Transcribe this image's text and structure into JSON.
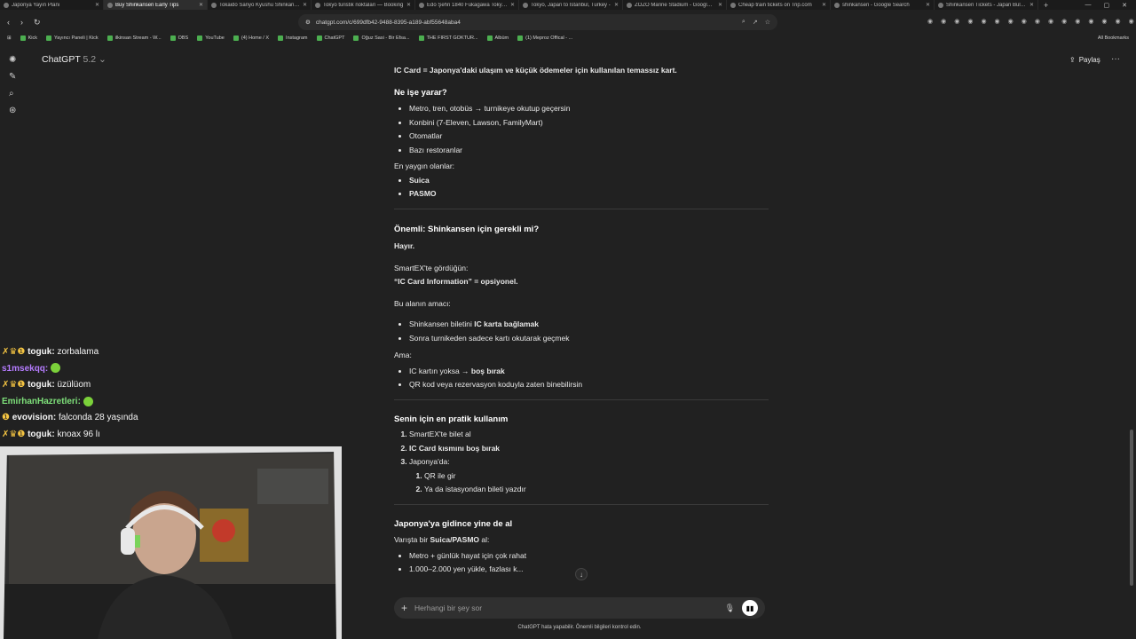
{
  "browser": {
    "tabs": [
      {
        "label": "Japonya Yayın Planı",
        "active": false
      },
      {
        "label": "Buy Shinkansen Early Tips",
        "active": true
      },
      {
        "label": "Tokaido Sanyo Kyushu Shinkansen",
        "active": false
      },
      {
        "label": "Tokyo turistik noktaları — Booking",
        "active": false
      },
      {
        "label": "Edo Şehri 1840 Fukagawa Tokyo'da",
        "active": false
      },
      {
        "label": "Tokyo, Japan to Istanbul, Turkey - ",
        "active": false
      },
      {
        "label": "ZOZO Marine Stadium - Google M",
        "active": false
      },
      {
        "label": "Cheap train tickets on Trip.com",
        "active": false
      },
      {
        "label": "shinkansen - Google Search",
        "active": false
      },
      {
        "label": "Shinkansen Tickets - Japan Bullet T",
        "active": false
      }
    ],
    "url": "chatgpt.com/c/699dfb42-9488-8395-a189-abf55648aba4",
    "bookmarks": [
      "Kick",
      "Yayıncı Paneli | Kick",
      "ilkinsan Stream - W...",
      "OBS",
      "YouTube",
      "(4) Home / X",
      "Instagram",
      "ChatGPT",
      "Oğuz Sasi - Bir Efsa...",
      "THE FIRST GOKTUR...",
      "Albüm",
      "(1) Meproz Offical - ..."
    ],
    "all_bookmarks": "All Bookmarks"
  },
  "app": {
    "model_name": "ChatGPT",
    "model_version": "5.2",
    "share_label": "Paylaş"
  },
  "message": {
    "intro_bold": "IC Card = Japonya'daki ulaşım ve küçük ödemeler için kullanılan temassız kart.",
    "s1_heading": "Ne işe yarar?",
    "s1_items": [
      "Metro, tren, otobüs → turnikeye okutup geçersin",
      "Konbini (7-Eleven, Lawson, FamilyMart)",
      "Otomatlar",
      "Bazı restoranlar"
    ],
    "s1_common": "En yaygın olanlar:",
    "s1_cards": [
      "Suica",
      "PASMO"
    ],
    "s2_heading": "Önemli: Shinkansen için gerekli mi?",
    "s2_answer": "Hayır.",
    "s2_seen": "SmartEX'te gördüğün:",
    "s2_field": "“IC Card Information” = opsiyonel.",
    "s2_purpose": "Bu alanın amacı:",
    "s2_purpose_items": [
      {
        "pre": "Shinkansen biletini ",
        "bold": "IC karta bağlamak"
      },
      {
        "pre": "Sonra turnikeden sadece kartı okutarak geçmek",
        "bold": ""
      }
    ],
    "s2_but": "Ama:",
    "s2_but_items": [
      {
        "pre": "IC kartın yoksa → ",
        "bold": "boş bırak"
      },
      {
        "pre": "QR kod veya rezervasyon koduyla zaten binebilirsin",
        "bold": ""
      }
    ],
    "s3_heading": "Senin için en pratik kullanım",
    "s3_steps": [
      "SmartEX'te bilet al",
      "IC Card kısmını boş bırak",
      "Japonya'da:"
    ],
    "s3_sub": [
      "QR ile gir",
      "Ya da istasyondan bileti yazdır"
    ],
    "s4_heading": "Japonya'ya gidince yine de al",
    "s4_line_pre": "Varışta bir ",
    "s4_line_bold": "Suica/PASMO",
    "s4_line_post": " al:",
    "s4_items": [
      "Metro + günlük hayat için çok rahat",
      "1.000–2.000 yen yükle, fazlası k..."
    ]
  },
  "composer": {
    "placeholder": "Herhangi bir şey sor",
    "disclaimer": "ChatGPT hata yapabilir. Önemli bilgileri kontrol edin."
  },
  "stream_chat": [
    {
      "user": "toguk",
      "text": "zorbalama",
      "color": "#f5f5f5",
      "badges": "✗♛❶"
    },
    {
      "user": "s1msekqq",
      "text": "",
      "color": "#b57cff",
      "badges": "",
      "emote": true
    },
    {
      "user": "toguk",
      "text": "üzülüom",
      "color": "#f5f5f5",
      "badges": "✗♛❶"
    },
    {
      "user": "EmirhanHazretleri",
      "text": "",
      "color": "#7ee07a",
      "badges": "",
      "emote": true
    },
    {
      "user": "evovision",
      "text": "falconda 28 yaşında",
      "color": "#f5f5f5",
      "badges": "❶"
    },
    {
      "user": "toguk",
      "text": "knoax 96 lı",
      "color": "#f5f5f5",
      "badges": "✗♛❶"
    }
  ]
}
